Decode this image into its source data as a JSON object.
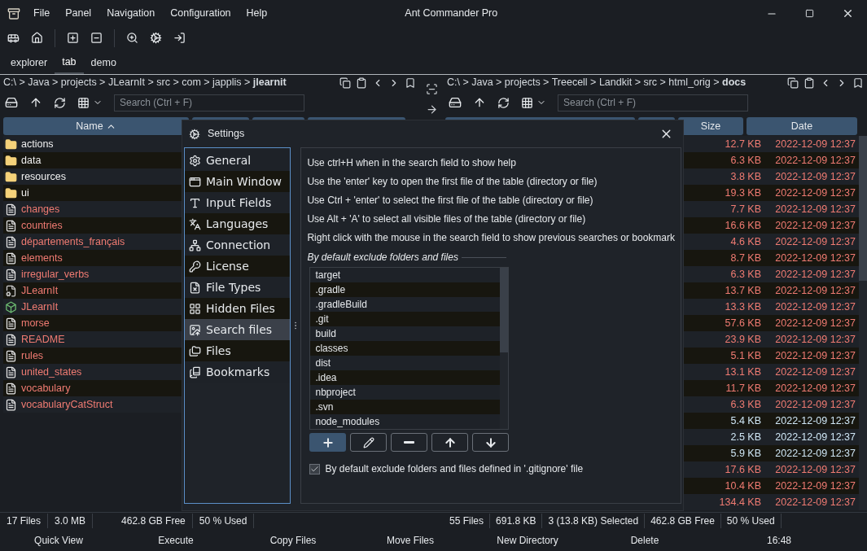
{
  "window": {
    "title": "Ant Commander Pro"
  },
  "menu": [
    "File",
    "Panel",
    "Navigation",
    "Configuration",
    "Help"
  ],
  "tabs": [
    {
      "label": "explorer",
      "selected": false
    },
    {
      "label": "tab",
      "selected": true
    },
    {
      "label": "demo",
      "selected": false
    }
  ],
  "left_panel": {
    "path": "C:\\ > Java > projects > JLearnIt > src > com > japplis > **jlearnit**",
    "search": {
      "placeholder": "Search (Ctrl + F)"
    },
    "columns": [
      "Name"
    ],
    "rows": [
      {
        "name": "actions",
        "kind": "folder"
      },
      {
        "name": "data",
        "kind": "folder"
      },
      {
        "name": "resources",
        "kind": "folder"
      },
      {
        "name": "ui",
        "kind": "folder"
      },
      {
        "name": "changes",
        "kind": "file"
      },
      {
        "name": "countries",
        "kind": "file"
      },
      {
        "name": "départements_français",
        "kind": "file"
      },
      {
        "name": "elements",
        "kind": "file"
      },
      {
        "name": "irregular_verbs",
        "kind": "file"
      },
      {
        "name": "JLearnIt",
        "kind": "config"
      },
      {
        "name": "JLearnIt",
        "kind": "app"
      },
      {
        "name": "morse",
        "kind": "file"
      },
      {
        "name": "README",
        "kind": "file"
      },
      {
        "name": "rules",
        "kind": "file"
      },
      {
        "name": "united_states",
        "kind": "file"
      },
      {
        "name": "vocabulary",
        "kind": "file"
      },
      {
        "name": "vocabularyCatStruct",
        "kind": "file"
      }
    ]
  },
  "right_panel": {
    "path": "C:\\ > Java > projects > Treecell > Landkit > src > html_orig > **docs**",
    "search": {
      "placeholder": "Search (Ctrl + F)"
    },
    "columns": [
      "Size",
      "Date"
    ],
    "rows": [
      {
        "size": "12.7 KB",
        "date": "2022-12-09 12:37",
        "color": "#f07b72"
      },
      {
        "size": "6.3 KB",
        "date": "2022-12-09 12:37",
        "color": "#f07b72"
      },
      {
        "size": "3.8 KB",
        "date": "2022-12-09 12:37",
        "color": "#f07b72"
      },
      {
        "size": "19.3 KB",
        "date": "2022-12-09 12:37",
        "color": "#f07b72"
      },
      {
        "size": "7.7 KB",
        "date": "2022-12-09 12:37",
        "color": "#f07b72"
      },
      {
        "size": "16.6 KB",
        "date": "2022-12-09 12:37",
        "color": "#f07b72"
      },
      {
        "size": "4.6 KB",
        "date": "2022-12-09 12:37",
        "color": "#f07b72"
      },
      {
        "size": "8.7 KB",
        "date": "2022-12-09 12:37",
        "color": "#f07b72"
      },
      {
        "size": "6.3 KB",
        "date": "2022-12-09 12:37",
        "color": "#f07b72"
      },
      {
        "size": "13.7 KB",
        "date": "2022-12-09 12:37",
        "color": "#f07b72"
      },
      {
        "size": "13.3 KB",
        "date": "2022-12-09 12:37",
        "color": "#f07b72"
      },
      {
        "size": "57.6 KB",
        "date": "2022-12-09 12:37",
        "color": "#f07b72"
      },
      {
        "size": "23.9 KB",
        "date": "2022-12-09 12:37",
        "color": "#f07b72"
      },
      {
        "size": "5.1 KB",
        "date": "2022-12-09 12:37",
        "color": "#f07b72"
      },
      {
        "size": "13.1 KB",
        "date": "2022-12-09 12:37",
        "color": "#f07b72"
      },
      {
        "size": "11.7 KB",
        "date": "2022-12-09 12:37",
        "color": "#f07b72"
      },
      {
        "size": "6.3 KB",
        "date": "2022-12-09 12:37",
        "color": "#f07b72"
      },
      {
        "size": "5.4 KB",
        "date": "2022-12-09 12:37",
        "color": "#cfe6f5"
      },
      {
        "size": "2.5 KB",
        "date": "2022-12-09 12:37",
        "color": "#cfe6f5"
      },
      {
        "size": "5.9 KB",
        "date": "2022-12-09 12:37",
        "color": "#cfe6f5"
      },
      {
        "size": "17.6 KB",
        "date": "2022-12-09 12:37",
        "color": "#f07b72"
      },
      {
        "size": "10.4 KB",
        "date": "2022-12-09 12:37",
        "color": "#f07b72"
      },
      {
        "size": "134.4 KB",
        "date": "2022-12-09 12:37",
        "color": "#f07b72"
      }
    ]
  },
  "dialog": {
    "title": "Settings",
    "nav": [
      {
        "label": "General",
        "selected": false
      },
      {
        "label": "Main Window",
        "selected": false
      },
      {
        "label": "Input Fields",
        "selected": false
      },
      {
        "label": "Languages",
        "selected": false
      },
      {
        "label": "Connection",
        "selected": false
      },
      {
        "label": "License",
        "selected": false
      },
      {
        "label": "File Types",
        "selected": false
      },
      {
        "label": "Hidden Files",
        "selected": false
      },
      {
        "label": "Search files",
        "selected": true
      },
      {
        "label": "Files",
        "selected": false
      },
      {
        "label": "Bookmarks",
        "selected": false
      }
    ],
    "help": [
      "Use ctrl+H when in the search field to show help",
      "Use the 'enter' key to open the first file of the table (directory or file)",
      "Use Ctrl + 'enter' to select the first file of the table (directory or file)",
      "Use Alt + 'A' to select all visible files of the table (directory or file)",
      "Right click with the mouse in the search field to show previous searches or bookmark"
    ],
    "exclude_group": "By default exclude folders and files",
    "exclude_list": [
      "target",
      ".gradle",
      ".gradleBuild",
      ".git",
      "build",
      "classes",
      "dist",
      ".idea",
      "nbproject",
      ".svn",
      "node_modules"
    ],
    "gitignore": {
      "label": "By default exclude folders and files defined in '.gitignore' file",
      "checked": true
    }
  },
  "status_left": [
    "17 Files",
    "3.0 MB",
    "462.8 GB Free",
    "50 % Used"
  ],
  "status_right": [
    "55 Files",
    "691.8 KB",
    "3 (13.8 KB) Selected",
    "462.8 GB Free",
    "50 % Used"
  ],
  "function_keys": [
    "Quick View",
    "Execute",
    "Copy Files",
    "Move Files",
    "New Directory",
    "Delete"
  ],
  "clock": "16:48"
}
